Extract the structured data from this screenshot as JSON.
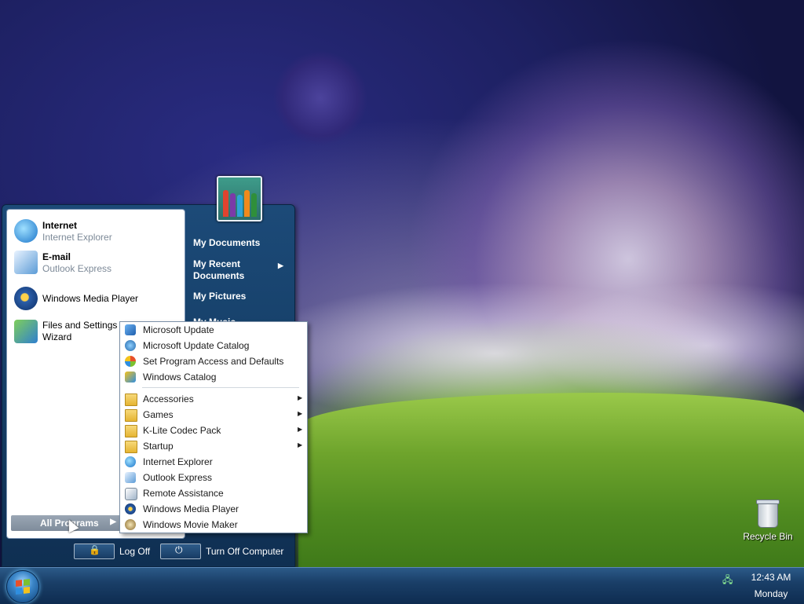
{
  "desktop": {
    "icons": [
      {
        "label": "Recycle Bin",
        "icon": "recycle-bin-icon"
      }
    ]
  },
  "start_menu": {
    "pinned": [
      {
        "title": "Internet",
        "subtitle": "Internet Explorer",
        "icon": "internet-explorer-icon"
      },
      {
        "title": "E-mail",
        "subtitle": "Outlook Express",
        "icon": "outlook-express-icon"
      }
    ],
    "recent": [
      {
        "label": "Windows Media Player",
        "icon": "media-player-icon"
      },
      {
        "label": "Files and Settings Transfer Wizard",
        "icon": "transfer-wizard-icon"
      }
    ],
    "all_programs": "All Programs",
    "places": [
      {
        "label": "My Documents"
      },
      {
        "label": "My Recent Documents",
        "has_submenu": true
      },
      {
        "label": "My Pictures"
      },
      {
        "label": "My Music"
      }
    ],
    "log_off": "Log Off",
    "turn_off": "Turn Off Computer"
  },
  "programs_menu": {
    "top_items": [
      {
        "label": "Microsoft Update",
        "icon": "update-icon"
      },
      {
        "label": "Microsoft Update Catalog",
        "icon": "globe-icon"
      },
      {
        "label": "Set Program Access and Defaults",
        "icon": "program-access-icon"
      },
      {
        "label": "Windows Catalog",
        "icon": "windows-catalog-icon"
      }
    ],
    "items": [
      {
        "label": "Accessories",
        "icon": "folder-icon",
        "has_submenu": true
      },
      {
        "label": "Games",
        "icon": "folder-icon",
        "has_submenu": true
      },
      {
        "label": "K-Lite Codec Pack",
        "icon": "folder-icon",
        "has_submenu": true
      },
      {
        "label": "Startup",
        "icon": "folder-icon",
        "has_submenu": true
      },
      {
        "label": "Internet Explorer",
        "icon": "internet-explorer-icon"
      },
      {
        "label": "Outlook Express",
        "icon": "outlook-express-icon"
      },
      {
        "label": "Remote Assistance",
        "icon": "remote-assistance-icon"
      },
      {
        "label": "Windows Media Player",
        "icon": "media-player-icon"
      },
      {
        "label": "Windows Movie Maker",
        "icon": "movie-maker-icon"
      }
    ]
  },
  "taskbar": {
    "time": "12:43 AM",
    "day": "Monday"
  },
  "colors": {
    "taskbar": "#1a3f68",
    "start_menu": "#153e66",
    "selection": "#8c98a7"
  }
}
